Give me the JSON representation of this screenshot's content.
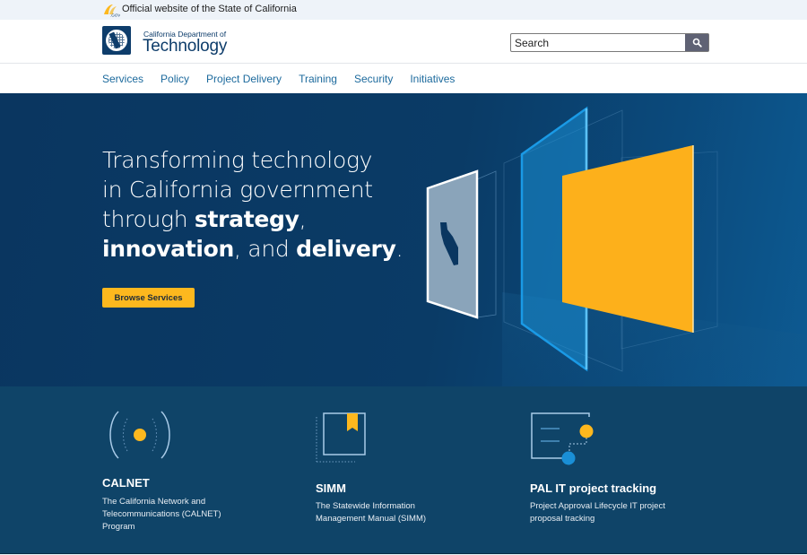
{
  "utility": {
    "logo_icon": "ca-gov-logo-icon",
    "official_text": "Official website of the State of California"
  },
  "header": {
    "logo_icon": "cdt-seal-icon",
    "dept_line1": "California Department of",
    "dept_line2": "Technology",
    "search": {
      "placeholder": "Search",
      "value": "",
      "button_icon": "search-icon"
    }
  },
  "nav": {
    "items": [
      {
        "label": "Services"
      },
      {
        "label": "Policy"
      },
      {
        "label": "Project Delivery"
      },
      {
        "label": "Training"
      },
      {
        "label": "Security"
      },
      {
        "label": "Initiatives"
      }
    ]
  },
  "hero": {
    "title_parts": {
      "line1": "Transforming technology",
      "line2": "in California government",
      "line3_pre": "through ",
      "strategy": "strategy",
      "comma1": ",",
      "innovation": "innovation",
      "and": ", and ",
      "delivery": "delivery",
      "period": "."
    },
    "cta_label": "Browse Services",
    "illustration": "layered-panels-illustration"
  },
  "services": [
    {
      "icon": "broadcast-signal-icon",
      "title": "CALNET",
      "description": "The California Network and Telecommunications (CALNET) Program"
    },
    {
      "icon": "bookmark-manual-icon",
      "title": "SIMM",
      "description": "The Statewide Information Management Manual (SIMM)"
    },
    {
      "icon": "project-tracking-icon",
      "title": "PAL IT project tracking",
      "description": "Project Approval Lifecycle IT project proposal tracking"
    }
  ],
  "colors": {
    "brand_navy": "#0e3d6b",
    "link_blue": "#1c6a9d",
    "accent_gold": "#fdb81e",
    "hero_bg": "#0a3660",
    "services_bg": "#0f4468",
    "bright_blue": "#1a8fd6"
  }
}
